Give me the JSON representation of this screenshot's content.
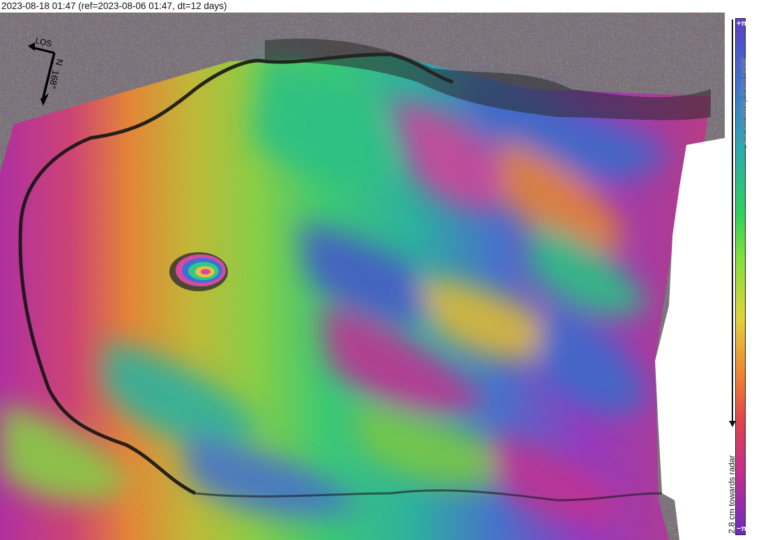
{
  "title": "2023-08-18 01:47 (ref=2023-08-06 01:47, dt=12 days)",
  "compass": {
    "los_label": "LOS",
    "north_label": "N",
    "heading_label": "168°"
  },
  "colorbar": {
    "top_symbol": "+π",
    "bottom_symbol": "−π",
    "towards_label": "2.8 cm towards radar",
    "away_label": "2.8 cm away from radar",
    "colors": [
      "#5b3fc8",
      "#3f6fd2",
      "#2aa6b8",
      "#2fd25b",
      "#7fe03a",
      "#e3d33a",
      "#f08a30",
      "#e0434b",
      "#c62d8e",
      "#6a2bc0"
    ]
  }
}
